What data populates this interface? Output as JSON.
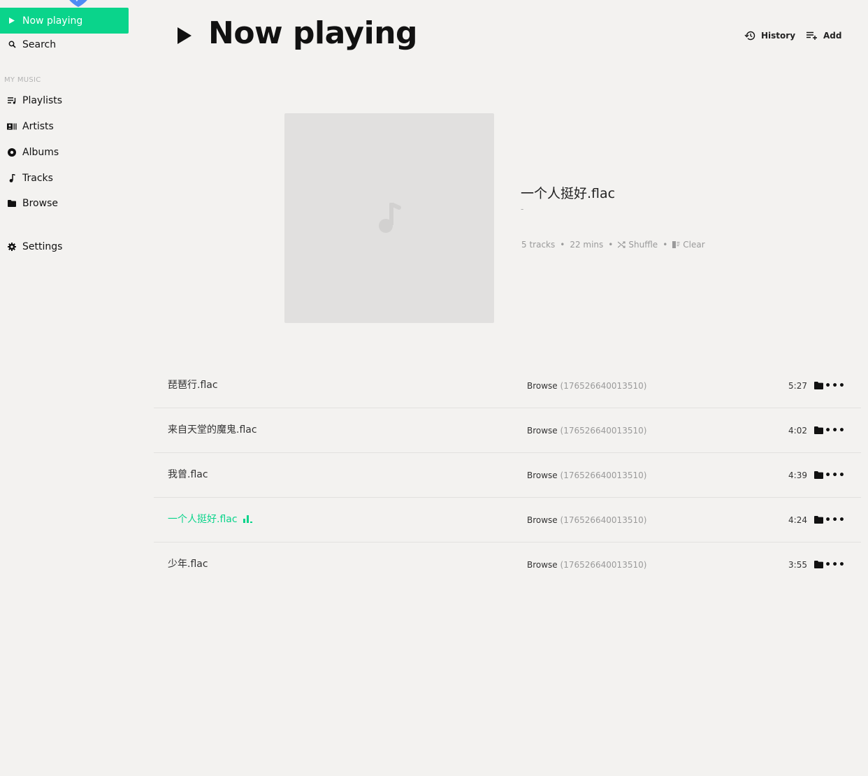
{
  "sidebar": {
    "now_playing": "Now playing",
    "search": "Search",
    "section_label": "MY MUSIC",
    "playlists": "Playlists",
    "artists": "Artists",
    "albums": "Albums",
    "tracks": "Tracks",
    "browse": "Browse",
    "settings": "Settings"
  },
  "header": {
    "title": "Now playing",
    "history": "History",
    "add": "Add"
  },
  "now_playing": {
    "title": "一个人挺好.flac",
    "artist": "-",
    "tracks_count": "5 tracks",
    "duration": "22 mins",
    "shuffle": "Shuffle",
    "clear": "Clear"
  },
  "tracks": [
    {
      "name": "琵琶行.flac",
      "source": "Browse",
      "source_detail": "(176526640013510)",
      "duration": "5:27"
    },
    {
      "name": "来自天堂的魔鬼.flac",
      "source": "Browse",
      "source_detail": "(176526640013510)",
      "duration": "4:02"
    },
    {
      "name": "我曾.flac",
      "source": "Browse",
      "source_detail": "(176526640013510)",
      "duration": "4:39"
    },
    {
      "name": "一个人挺好.flac",
      "source": "Browse",
      "source_detail": "(176526640013510)",
      "duration": "4:24"
    },
    {
      "name": "少年.flac",
      "source": "Browse",
      "source_detail": "(176526640013510)",
      "duration": "3:55"
    }
  ],
  "icons": {
    "play": "play-icon",
    "search": "search-icon",
    "playlists": "playlist-icon",
    "artists": "artist-icon",
    "albums": "album-icon",
    "tracks": "music-note-icon",
    "browse": "folder-icon",
    "settings": "gear-icon",
    "history": "history-icon",
    "add": "add-to-queue-icon",
    "shuffle": "shuffle-icon",
    "clear": "clear-queue-icon",
    "more": "more-icon"
  },
  "colors": {
    "accent": "#0ad48b",
    "background": "#f3f2f0",
    "art_placeholder": "#e1e0df"
  },
  "playing_index": 3
}
